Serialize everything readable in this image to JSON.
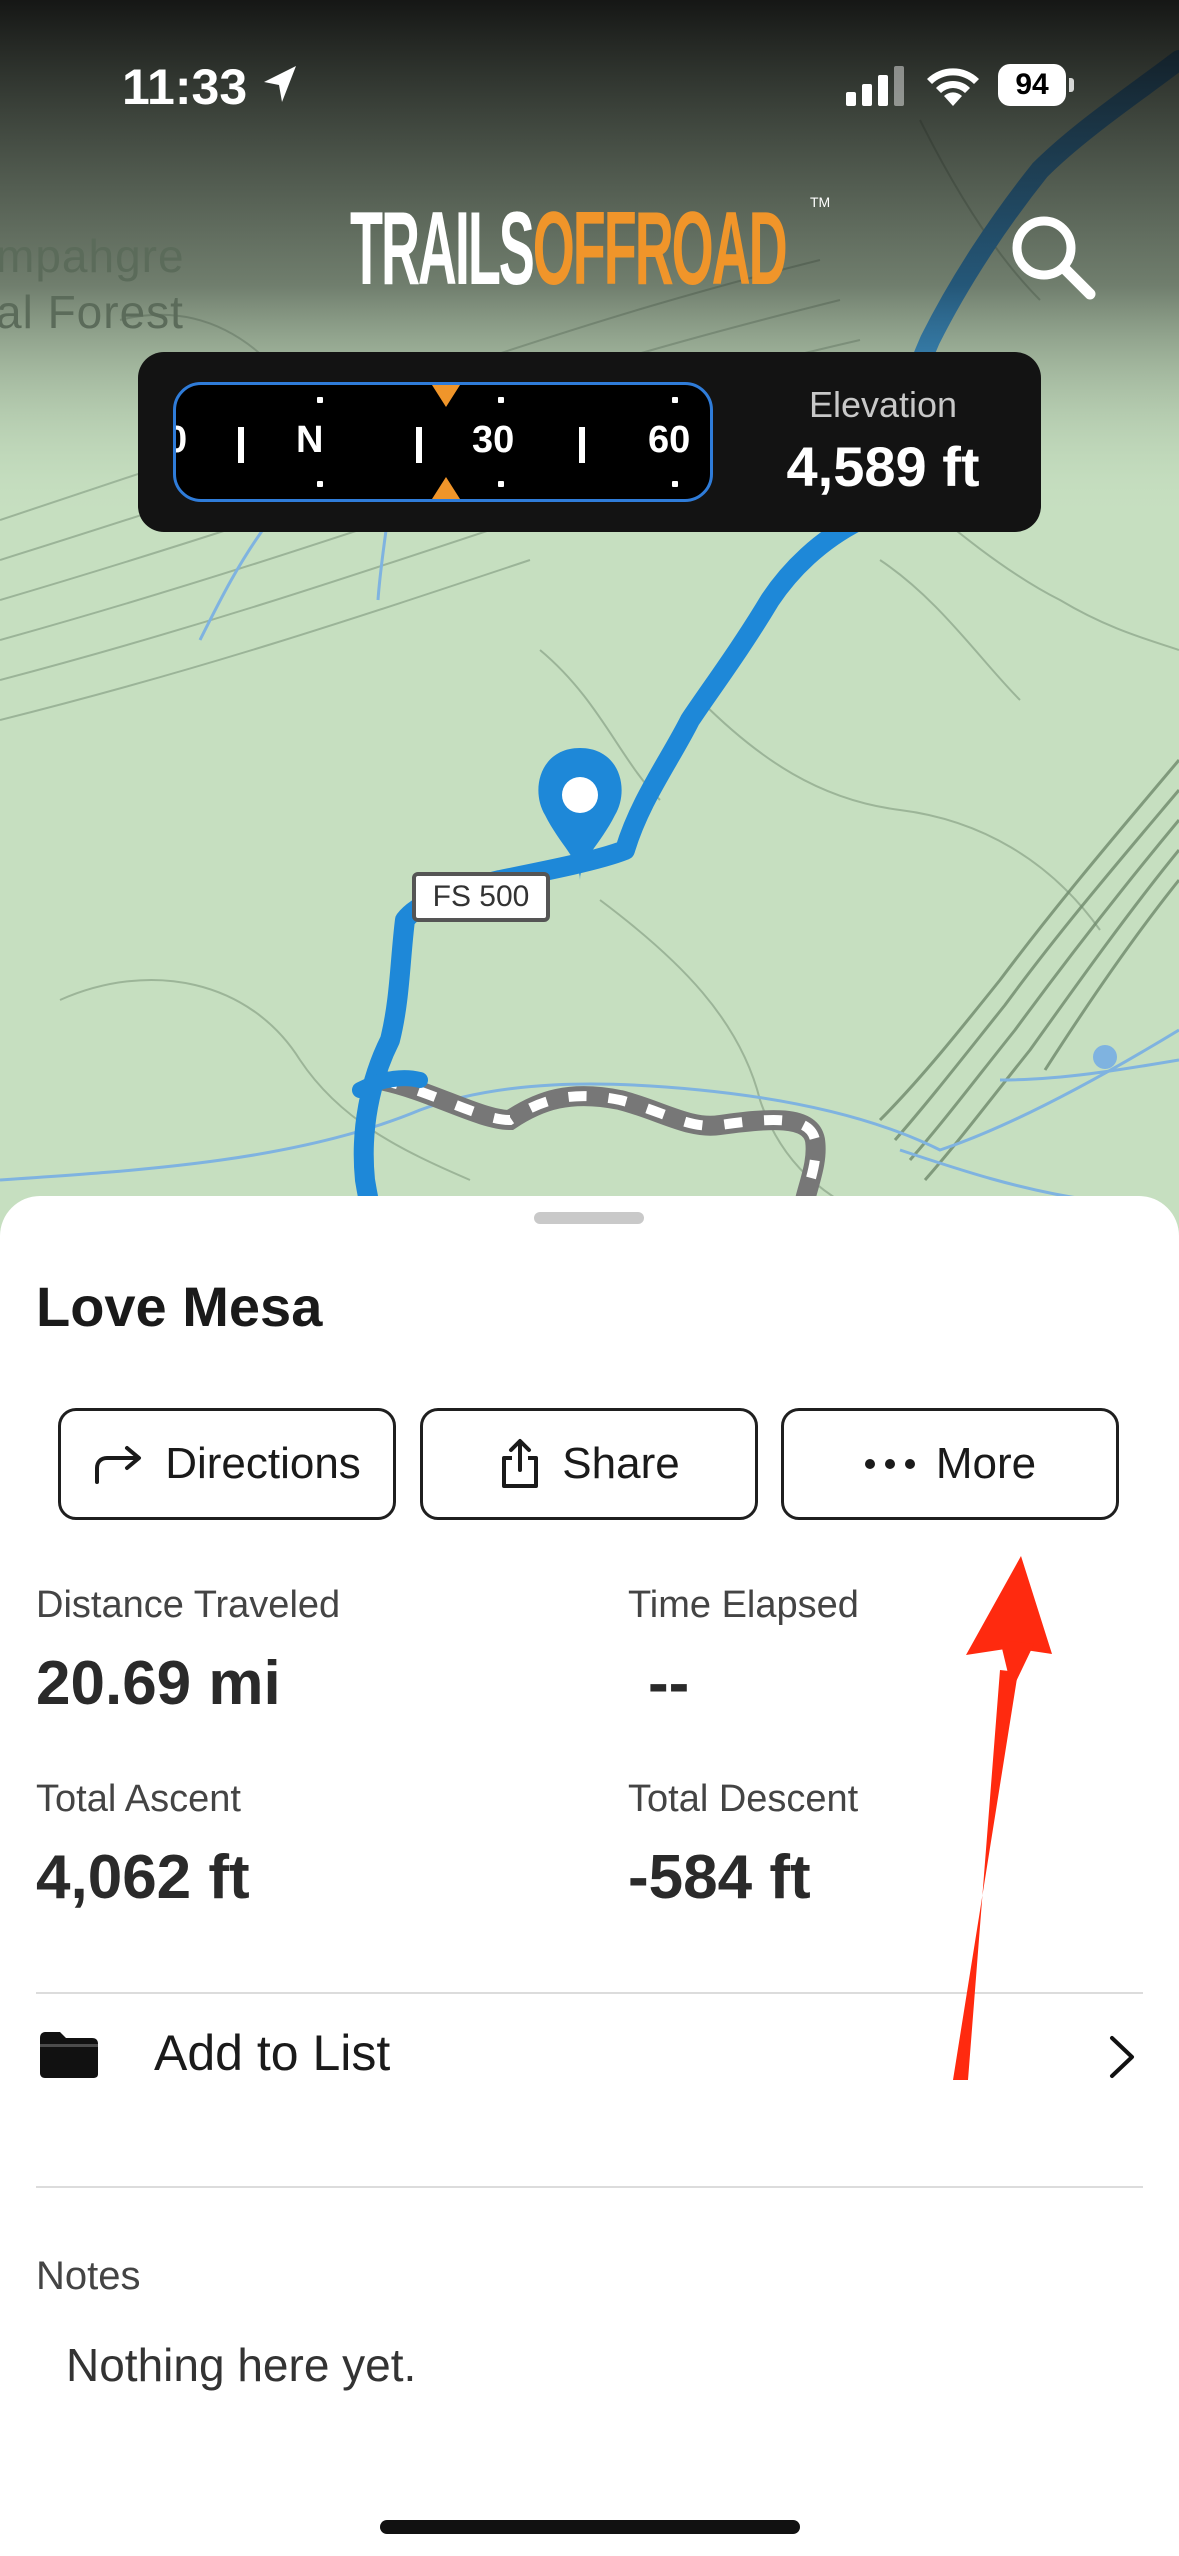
{
  "status_bar": {
    "time": "11:33",
    "battery": "94"
  },
  "map": {
    "logo_part1": "TRAILS",
    "logo_part2": "OFFROAD",
    "logo_tm": "TM",
    "forest_label_line1": "mpahgre",
    "forest_label_line2": "al Forest",
    "road_sign": "FS 500"
  },
  "compass": {
    "labels": [
      "0",
      "N",
      "30",
      "60"
    ]
  },
  "elevation": {
    "label": "Elevation",
    "value": "4,589 ft"
  },
  "trail": {
    "name": "Love Mesa",
    "actions": {
      "directions": "Directions",
      "share": "Share",
      "more": "More"
    },
    "stats": {
      "distance_label": "Distance Traveled",
      "distance_value": "20.69 mi",
      "time_label": "Time Elapsed",
      "time_value": "--",
      "ascent_label": "Total Ascent",
      "ascent_value": "4,062 ft",
      "descent_label": "Total Descent",
      "descent_value": "-584 ft"
    },
    "add_to_list": "Add to List",
    "notes_label": "Notes",
    "notes_value": "Nothing here yet."
  },
  "colors": {
    "map_green": "#c6dfc0",
    "route_blue": "#1e88d8",
    "accent_orange": "#f0952a",
    "annotation_red": "#ff2a0f"
  }
}
